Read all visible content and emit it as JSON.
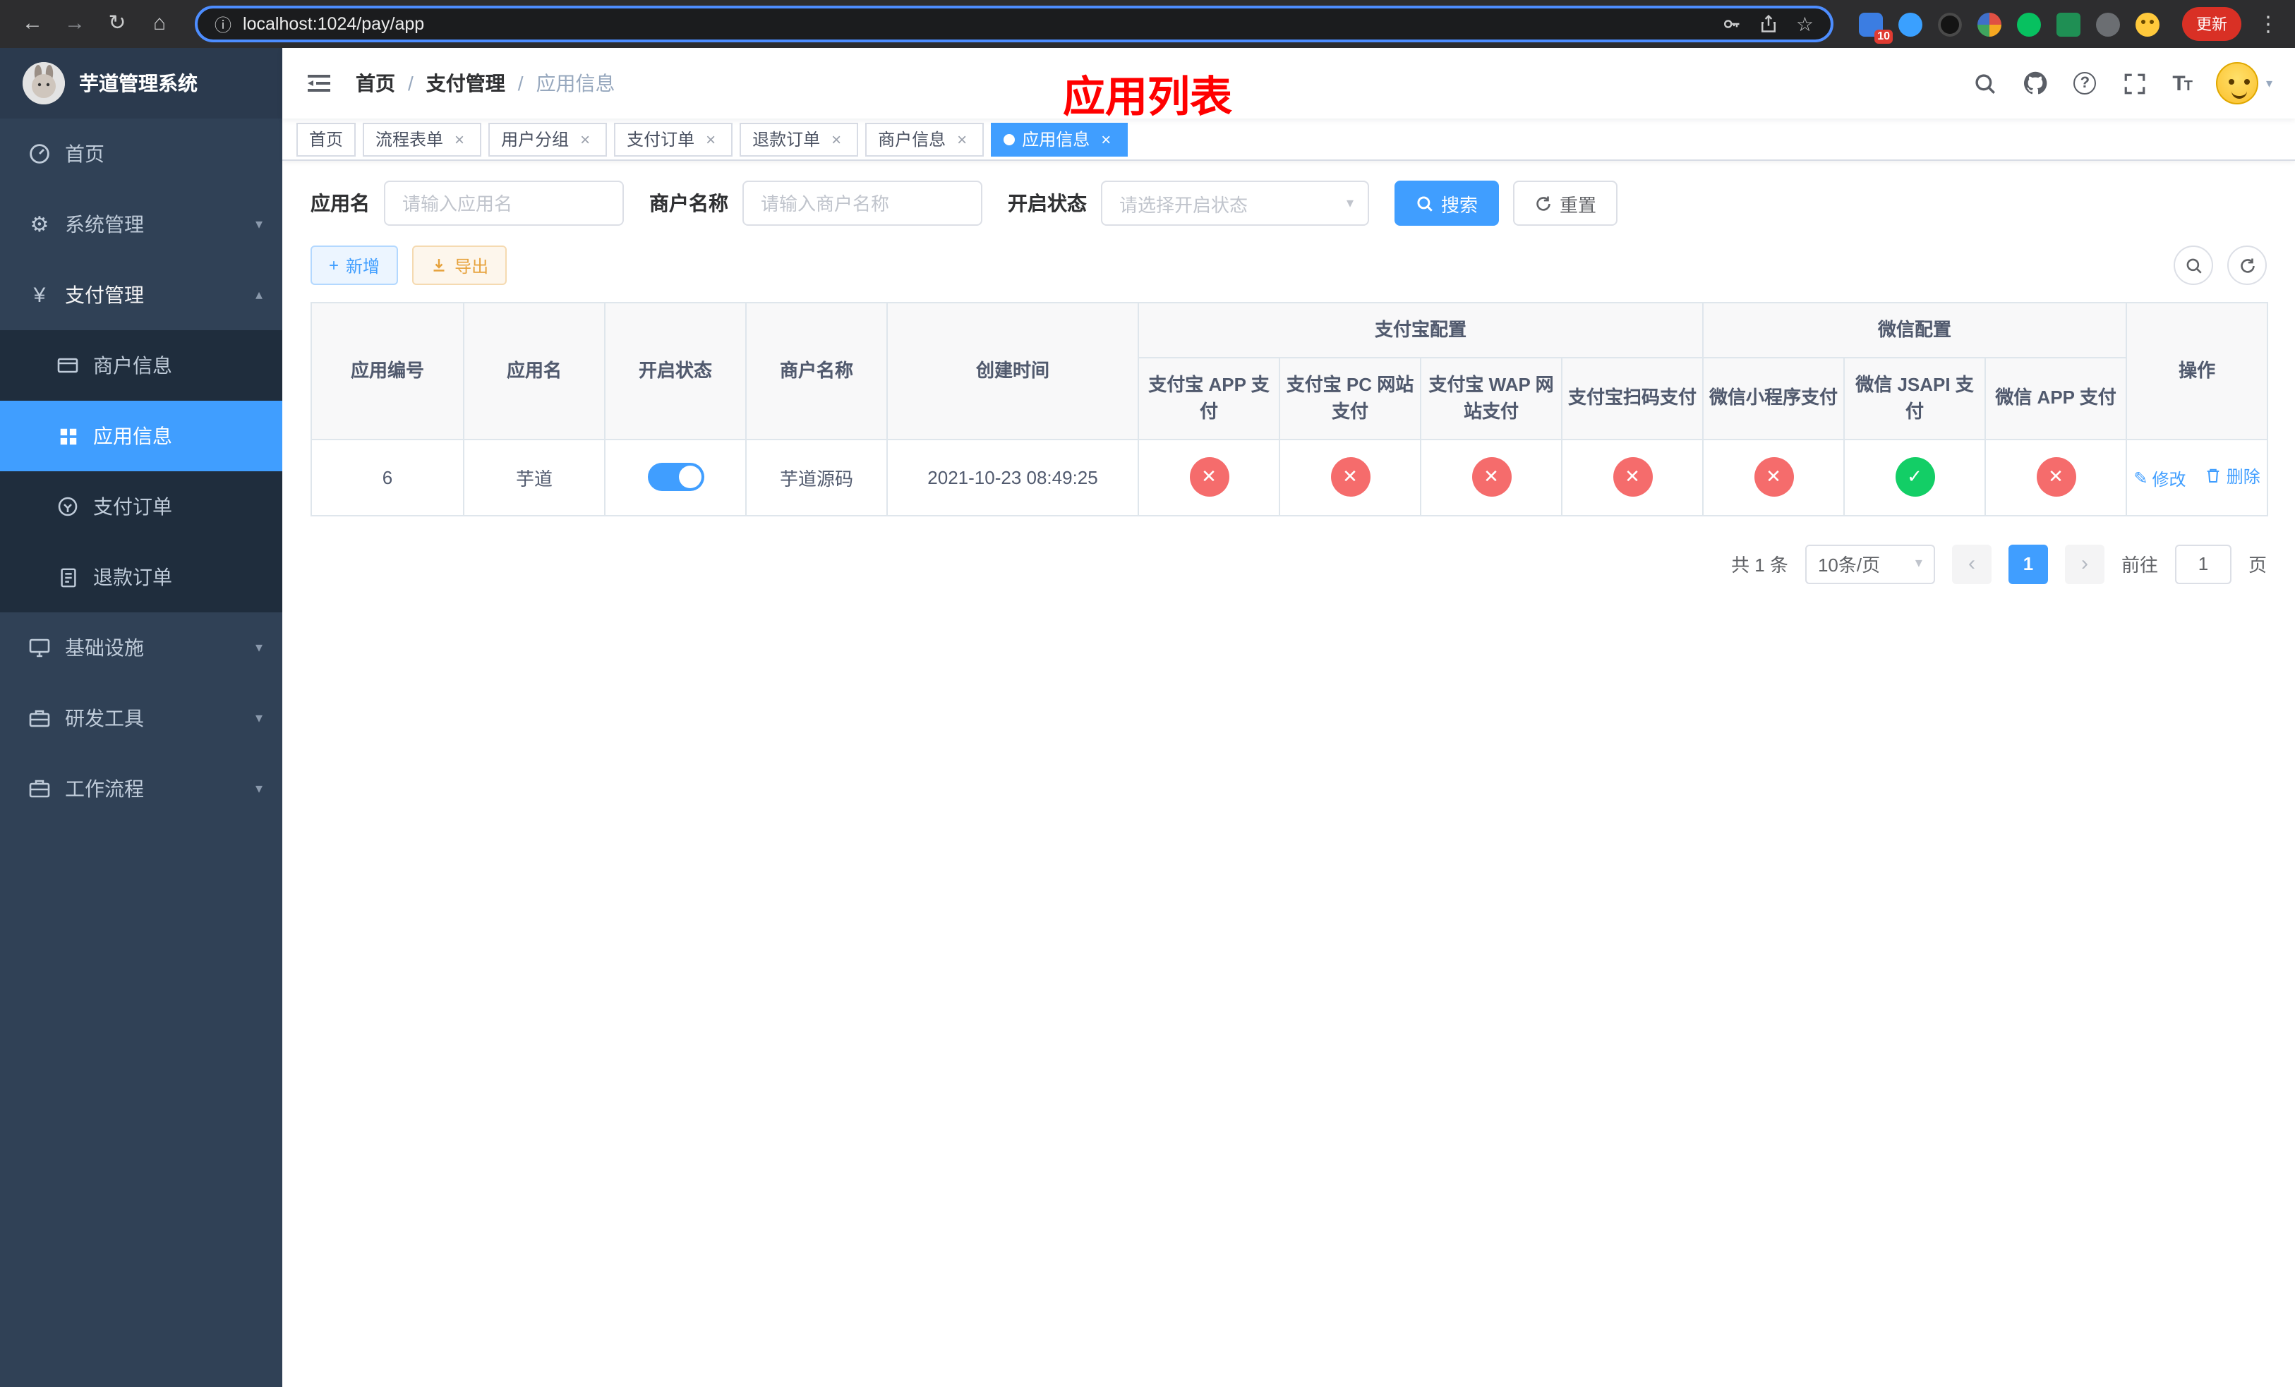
{
  "browser": {
    "url": "localhost:1024/pay/app",
    "extension_badge": "10",
    "update_button": "更新"
  },
  "icons": {
    "back": "←",
    "forward": "→",
    "reload": "↻",
    "home": "⌂",
    "info": "ⓘ",
    "star": "☆",
    "menu_dots": "⋮",
    "gear": "⚙",
    "yen": "¥",
    "caret_down": "▾",
    "caret_up": "▴",
    "plus": "+",
    "edit": "✎",
    "prev": "‹",
    "next": "›",
    "close": "×",
    "check": "✓",
    "cross": "✕",
    "question": "?",
    "letter_t_big": "T",
    "letter_t_small": "T"
  },
  "sidebar": {
    "title": "芋道管理系统",
    "home": "首页",
    "system": "系统管理",
    "payment": "支付管理",
    "sub_merchant": "商户信息",
    "sub_app": "应用信息",
    "sub_order": "支付订单",
    "sub_refund": "退款订单",
    "infra": "基础设施",
    "devtools": "研发工具",
    "workflow": "工作流程"
  },
  "navbar": {
    "breadcrumb": [
      "首页",
      "支付管理",
      "应用信息"
    ],
    "separator": "/",
    "annotation": "应用列表"
  },
  "tabs": [
    {
      "label": "首页"
    },
    {
      "label": "流程表单"
    },
    {
      "label": "用户分组"
    },
    {
      "label": "支付订单"
    },
    {
      "label": "退款订单"
    },
    {
      "label": "商户信息"
    },
    {
      "label": "应用信息"
    }
  ],
  "filters": {
    "app_name_label": "应用名",
    "app_name_placeholder": "请输入应用名",
    "merchant_label": "商户名称",
    "merchant_placeholder": "请输入商户名称",
    "status_label": "开启状态",
    "status_placeholder": "请选择开启状态",
    "search_button": "搜索",
    "reset_button": "重置"
  },
  "toolbar": {
    "add_button": "新增",
    "export_button": "导出"
  },
  "table": {
    "col_app_id": "应用编号",
    "col_app_name": "应用名",
    "col_status": "开启状态",
    "col_merchant": "商户名称",
    "col_created": "创建时间",
    "group_alipay": "支付宝配置",
    "group_wechat": "微信配置",
    "col_alipay_app": "支付宝 APP 支付",
    "col_alipay_pc": "支付宝 PC 网站支付",
    "col_alipay_wap": "支付宝 WAP 网站支付",
    "col_alipay_qr": "支付宝扫码支付",
    "col_wx_mini": "微信小程序支付",
    "col_wx_jsapi": "微信 JSAPI 支付",
    "col_wx_app": "微信 APP 支付",
    "col_actions": "操作",
    "rows": [
      {
        "id": "6",
        "name": "芋道",
        "enabled": true,
        "merchant": "芋道源码",
        "created": "2021-10-23 08:49:25",
        "channels": {
          "alipay_app": "no",
          "alipay_pc": "no",
          "alipay_wap": "no",
          "alipay_qr": "no",
          "wx_mini": "no",
          "wx_jsapi": "yes",
          "wx_app": "no"
        },
        "edit_label": "修改",
        "delete_label": "删除"
      }
    ]
  },
  "pagination": {
    "total": "共 1 条",
    "page_size": "10条/页",
    "page": "1",
    "goto": "前往",
    "goto_value": "1",
    "unit": "页"
  },
  "colors": {
    "accent_blue": "#409eff",
    "status_off_red": "#f56c6c",
    "status_on_green": "#13ce66",
    "annotation_red": "#ff0000",
    "sidebar_bg": "#304156",
    "submenu_bg": "#1f2d3d"
  }
}
